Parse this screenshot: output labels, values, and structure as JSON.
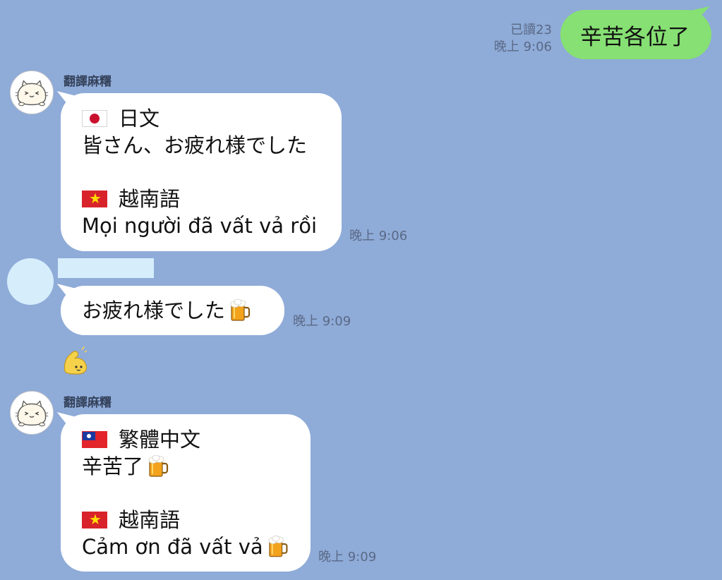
{
  "outgoing": {
    "text": "辛苦各位了",
    "read_status": "已讀23",
    "time": "晚上 9:06"
  },
  "messages": [
    {
      "sender": "翻譯麻糬",
      "lines": [
        {
          "flag": "japan-flag-icon",
          "text": "日文"
        },
        {
          "text": "皆さん、お疲れ様でした"
        },
        {
          "flag": "vietnam-flag-icon",
          "text": "越南語"
        },
        {
          "text": "Mọi người đã vất vả rồi"
        }
      ],
      "time": "晚上 9:06"
    },
    {
      "sender": "",
      "text": "お疲れ様でした",
      "emoji": "beer-mug-icon",
      "time": "晚上 9:09",
      "sticker": "flexing-biceps-sticker"
    },
    {
      "sender": "翻譯麻糬",
      "lines": [
        {
          "flag": "taiwan-flag-icon",
          "text": "繁體中文"
        },
        {
          "text": "辛苦了",
          "emoji": "beer-mug-icon"
        },
        {
          "flag": "vietnam-flag-icon",
          "text": "越南語"
        },
        {
          "text": "Cảm ơn đã vất vả",
          "emoji": "beer-mug-icon"
        }
      ],
      "time": "晚上 9:09"
    }
  ],
  "colors": {
    "background": "#8fabd8",
    "outgoing_bubble": "#86e073",
    "incoming_bubble": "#ffffff",
    "meta_text": "#5a6a86"
  }
}
